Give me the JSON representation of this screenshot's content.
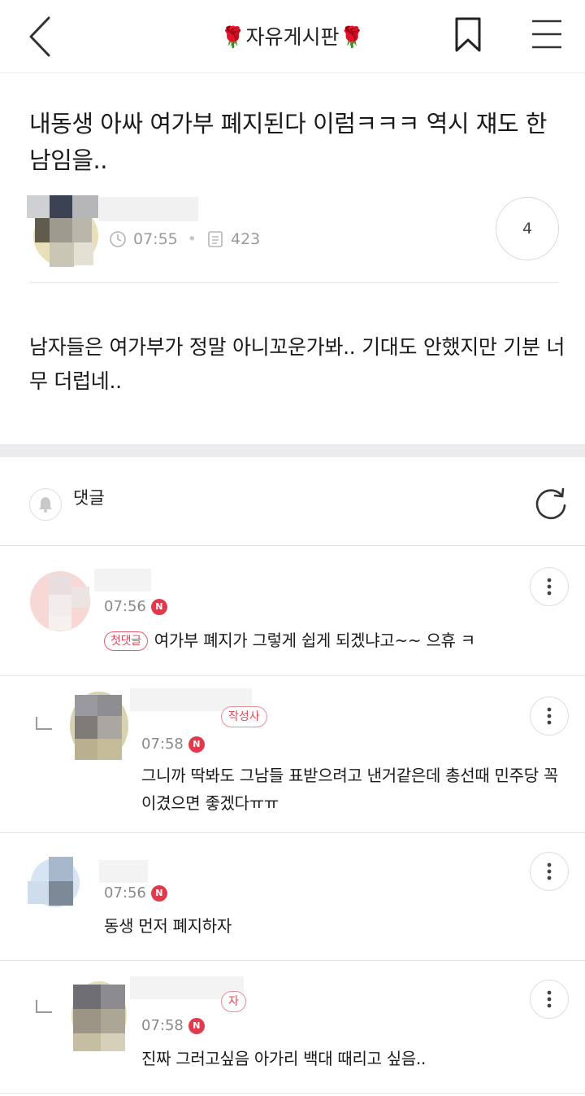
{
  "header": {
    "title": "🌹자유게시판🌹",
    "back_icon": "chevron-left-icon",
    "bookmark_icon": "bookmark-icon",
    "menu_icon": "hamburger-menu-icon"
  },
  "post": {
    "title": "내동생 아싸 여가부 폐지된다 이럼ㅋㅋㅋ 역시 쟤도 한남임을..",
    "time": "07:55",
    "views": "423",
    "comment_count": "4",
    "body": "남자들은 여가부가 정말 아니꼬운가봐.. 기대도 안했지만 기분 너무 더럽네.."
  },
  "comments_section": {
    "label": "댓글"
  },
  "comments": [
    {
      "time": "07:56",
      "new_badge": "N",
      "first_badge": "첫댓글",
      "text": "여가부 폐지가 그렇게 쉽게 되겠냐고~~ 으휴 ㅋ"
    },
    {
      "time": "07:58",
      "new_badge": "N",
      "role_badge": "작성사",
      "text": "그니까 딱봐도 그남들 표받으려고 낸거같은데 총선때 민주당 꼭 이겼으면 좋겠다ㅠㅠ"
    },
    {
      "time": "07:56",
      "new_badge": "N",
      "text": "동생 먼저 폐지하자"
    },
    {
      "time": "07:58",
      "new_badge": "N",
      "role_badge": "자",
      "text": "진짜 그러고싶음 아가리 백대 때리고 싶음.."
    }
  ],
  "colors": {
    "accent_red": "#e23a4d",
    "divider": "#e4e4e4",
    "section_gap": "#ebebed"
  }
}
